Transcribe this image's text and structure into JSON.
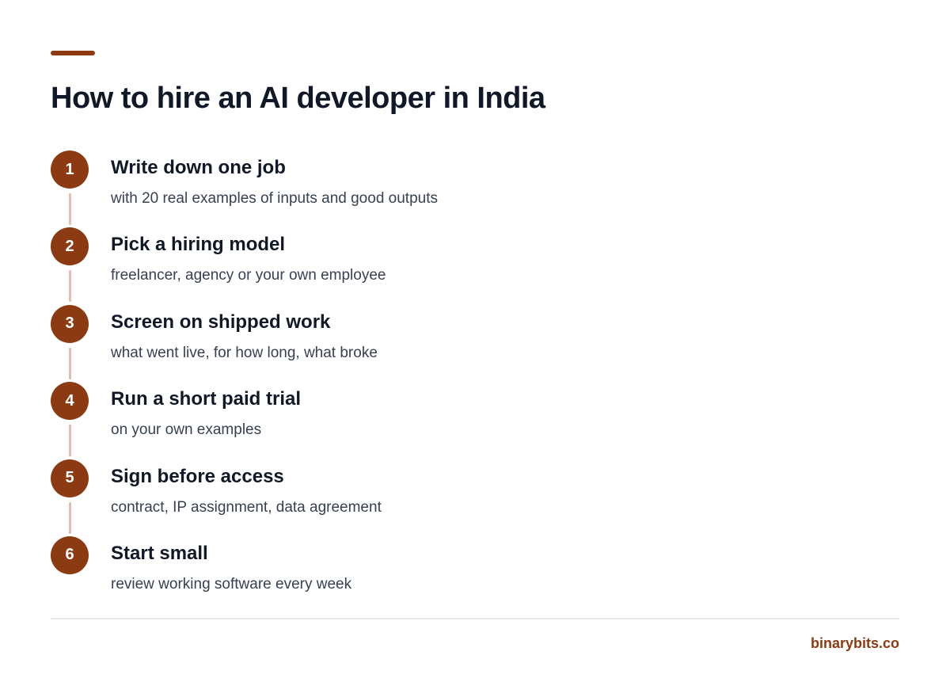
{
  "title": "How to hire an AI developer in India",
  "accent_color": "#8b3a12",
  "steps": [
    {
      "number": "1",
      "title": "Write down one job",
      "description": "with 20 real examples of inputs and good outputs"
    },
    {
      "number": "2",
      "title": "Pick a hiring model",
      "description": "freelancer, agency or your own employee"
    },
    {
      "number": "3",
      "title": "Screen on shipped work",
      "description": "what went live, for how long, what broke"
    },
    {
      "number": "4",
      "title": "Run a short paid trial",
      "description": "on your own examples"
    },
    {
      "number": "5",
      "title": "Sign before access",
      "description": "contract, IP assignment, data agreement"
    },
    {
      "number": "6",
      "title": "Start small",
      "description": "review working software every week"
    }
  ],
  "footer": {
    "brand": "binarybits.co"
  }
}
